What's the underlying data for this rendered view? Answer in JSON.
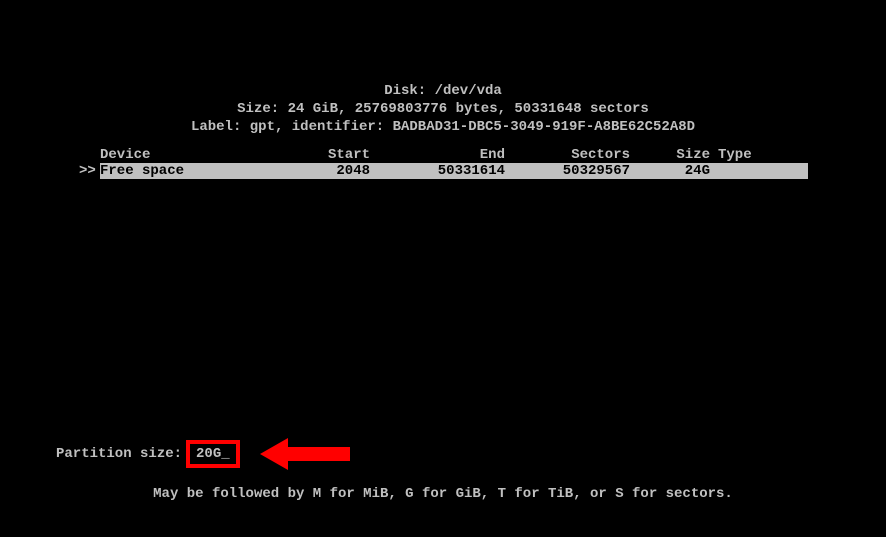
{
  "header": {
    "disk_line": "Disk: /dev/vda",
    "size_line": "Size: 24 GiB, 25769803776 bytes, 50331648 sectors",
    "label_line": "Label: gpt, identifier: BADBAD31-DBC5-3049-919F-A8BE62C52A8D"
  },
  "table": {
    "headers": {
      "device": "Device",
      "start": "Start",
      "end": "End",
      "sectors": "Sectors",
      "size": "Size",
      "type": "Type"
    },
    "row": {
      "marker": ">>",
      "device": "Free space",
      "start": "2048",
      "end": "50331614",
      "sectors": "50329567",
      "size": "24G",
      "type": ""
    }
  },
  "partition": {
    "label": "Partition size: ",
    "value": "20G",
    "cursor": "_"
  },
  "hint": "May be followed by M for MiB, G for GiB, T for TiB, or S for sectors."
}
